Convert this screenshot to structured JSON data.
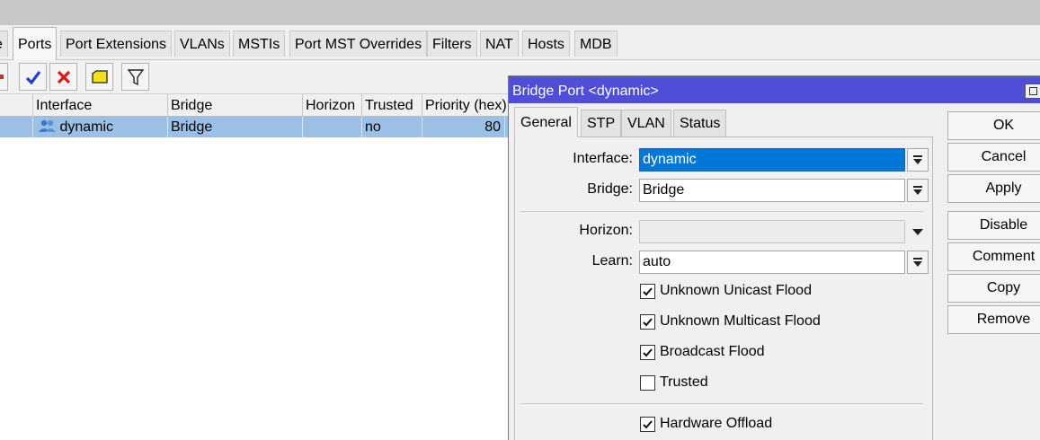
{
  "tabs": [
    {
      "label": "e"
    },
    {
      "label": "Ports"
    },
    {
      "label": "Port Extensions"
    },
    {
      "label": "VLANs"
    },
    {
      "label": "MSTIs"
    },
    {
      "label": "Port MST Overrides"
    },
    {
      "label": "Filters"
    },
    {
      "label": "NAT"
    },
    {
      "label": "Hosts"
    },
    {
      "label": "MDB"
    }
  ],
  "toolbar": {
    "icons": [
      "remove-icon",
      "enable-check-icon",
      "disable-x-icon",
      "comment-icon",
      "filter-icon"
    ]
  },
  "table": {
    "columns": [
      "Interface",
      "Bridge",
      "Horizon",
      "Trusted",
      "Priority (hex)"
    ],
    "rows": [
      {
        "icon": "bridge-port-icon",
        "interface": "dynamic",
        "bridge": "Bridge",
        "horizon": "",
        "trusted": "no",
        "priority": "80"
      }
    ]
  },
  "dialog": {
    "title": "Bridge Port <dynamic>",
    "tabs": [
      "General",
      "STP",
      "VLAN",
      "Status"
    ],
    "fields": {
      "interface": {
        "label": "Interface:",
        "value": "dynamic"
      },
      "bridge": {
        "label": "Bridge:",
        "value": "Bridge"
      },
      "horizon": {
        "label": "Horizon:",
        "value": ""
      },
      "learn": {
        "label": "Learn:",
        "value": "auto"
      }
    },
    "checkboxes": [
      {
        "label": "Unknown Unicast Flood",
        "checked": true
      },
      {
        "label": "Unknown Multicast Flood",
        "checked": true
      },
      {
        "label": "Broadcast Flood",
        "checked": true
      },
      {
        "label": "Trusted",
        "checked": false
      },
      {
        "label": "Hardware Offload",
        "checked": true
      }
    ],
    "buttons": [
      "OK",
      "Cancel",
      "Apply",
      "Disable",
      "Comment",
      "Copy",
      "Remove"
    ]
  },
  "colors": {
    "title_bar": "#4e4ed6",
    "row_selected": "#9cbfe6",
    "field_selected": "#0078d7"
  }
}
